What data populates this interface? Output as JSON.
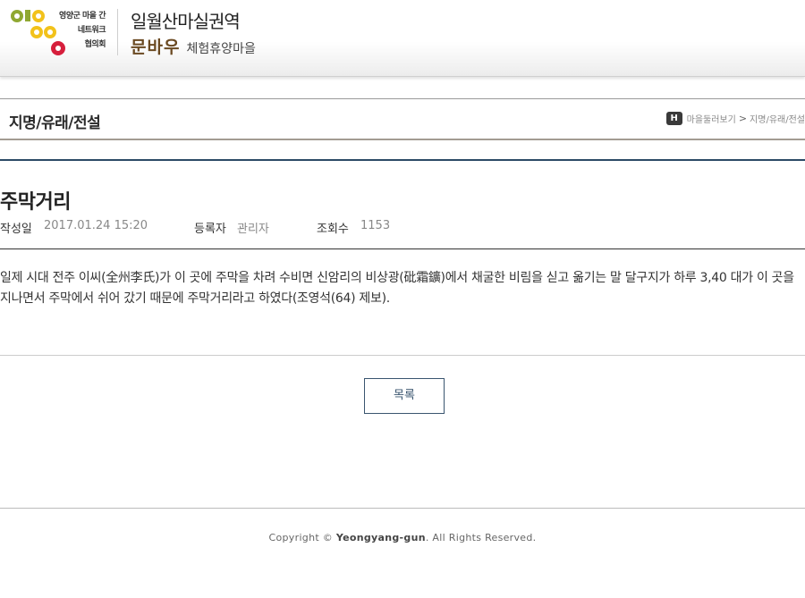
{
  "header": {
    "org_lines": [
      "영양군 마을 간",
      "네트워크",
      "협의회"
    ],
    "village_name": "일월산마실권역",
    "brand_name": "문바우",
    "brand_sub": "체험휴양마을"
  },
  "titlebar": {
    "title": "지명/유래/전설",
    "breadcrumb": {
      "home_label": "H",
      "items": [
        "마을둘러보기",
        "지명/유래/전설"
      ],
      "separator": ">"
    }
  },
  "post": {
    "title": "주막거리",
    "meta": {
      "date_label": "작성일",
      "date_value": "2017.01.24 15:20",
      "author_label": "등록자",
      "author_value": "관리자",
      "views_label": "조회수",
      "views_value": "1153"
    },
    "body": "일제 시대 전주 이씨(全州李氏)가 이 곳에 주막을 차려 수비면 신암리의 비상광(砒霜鑛)에서 채굴한 비림을 싣고 옮기는 말 달구지가 하루 3,40 대가 이 곳을 지나면서 주막에서 쉬어 갔기 때문에 주막거리라고 하였다(조영석(64) 제보)."
  },
  "actions": {
    "list_button": "목록"
  },
  "footer": {
    "copyright_prefix": "Copyright ©",
    "brand": "Yeongyang-gun",
    "suffix": ". All Rights Reserved."
  },
  "colors": {
    "logo_green": "#8fa832",
    "logo_yellow": "#f2c21b",
    "logo_red": "#d61f3c",
    "accent_navy": "#2c4a66",
    "brand_brown": "#6b4a22"
  }
}
